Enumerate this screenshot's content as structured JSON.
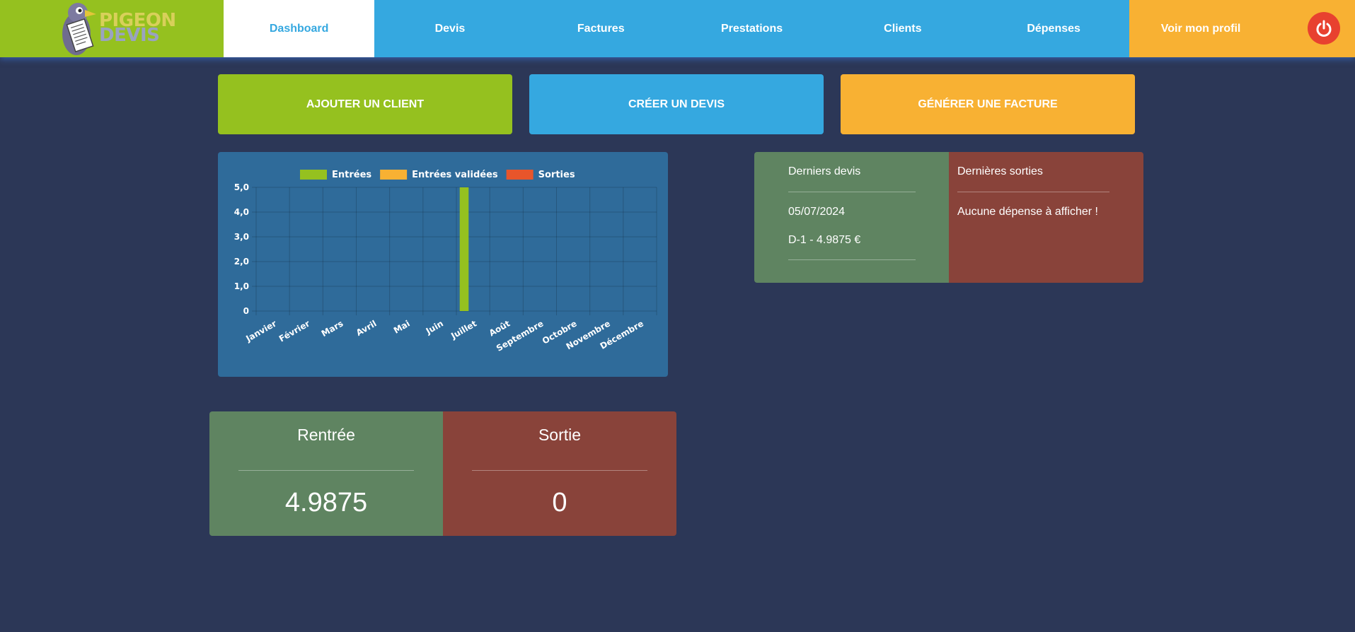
{
  "brand": {
    "line1": "PIGEON",
    "line2": "DEVIS"
  },
  "nav": {
    "items": [
      {
        "label": "Dashboard",
        "active": true
      },
      {
        "label": "Devis",
        "active": false
      },
      {
        "label": "Factures",
        "active": false
      },
      {
        "label": "Prestations",
        "active": false
      },
      {
        "label": "Clients",
        "active": false
      },
      {
        "label": "Dépenses",
        "active": false
      }
    ],
    "profile_label": "Voir mon profil",
    "power_icon": "power-icon"
  },
  "actions": {
    "add_client": "AJOUTER UN CLIENT",
    "create_quote": "CRÉER UN DEVIS",
    "generate_invoice": "GÉNÉRER UNE FACTURE"
  },
  "chart_data": {
    "type": "bar",
    "title": "",
    "xlabel": "",
    "ylabel": "",
    "categories": [
      "Janvier",
      "Février",
      "Mars",
      "Avril",
      "Mai",
      "Juin",
      "Juillet",
      "Août",
      "Septembre",
      "Octobre",
      "Novembre",
      "Décembre"
    ],
    "series": [
      {
        "name": "Entrées",
        "color": "#95c11f",
        "values": [
          0,
          0,
          0,
          0,
          0,
          0,
          5,
          0,
          0,
          0,
          0,
          0
        ]
      },
      {
        "name": "Entrées validées",
        "color": "#f8b133",
        "values": [
          0,
          0,
          0,
          0,
          0,
          0,
          0,
          0,
          0,
          0,
          0,
          0
        ]
      },
      {
        "name": "Sorties",
        "color": "#e8552b",
        "values": [
          0,
          0,
          0,
          0,
          0,
          0,
          0,
          0,
          0,
          0,
          0,
          0
        ]
      }
    ],
    "ylim": [
      0,
      5
    ],
    "yticks": [
      0,
      1,
      2,
      3,
      4,
      5
    ],
    "ytick_labels": [
      "0",
      "1,0",
      "2,0",
      "3,0",
      "4,0",
      "5,0"
    ],
    "legend": "top",
    "grid": true
  },
  "latest_quotes": {
    "title": "Derniers devis",
    "date": "05/07/2024",
    "entry": "D-1 - 4.9875 €"
  },
  "latest_expenses": {
    "title": "Dernières sorties",
    "empty_text": "Aucune dépense à afficher !"
  },
  "totals": {
    "in_label": "Rentrée",
    "in_value": "4.9875",
    "out_label": "Sortie",
    "out_value": "0"
  },
  "colors": {
    "background": "#2c3757",
    "green": "#95c11f",
    "blue": "#35a8e0",
    "orange": "#f8b133",
    "red": "#e8412f",
    "panel_green": "#5f8461",
    "panel_red": "#89433a",
    "chart_bg": "#2f6b9a"
  }
}
